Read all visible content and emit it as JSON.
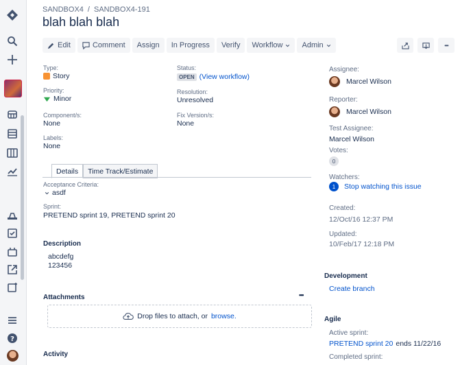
{
  "breadcrumb": {
    "project": "SANDBOX4",
    "issue_key": "SANDBOX4-191"
  },
  "issue": {
    "title": "blah blah blah"
  },
  "toolbar": {
    "edit": "Edit",
    "comment": "Comment",
    "assign": "Assign",
    "in_progress": "In Progress",
    "verify": "Verify",
    "workflow": "Workflow",
    "admin": "Admin",
    "more": "•••"
  },
  "details": {
    "type_label": "Type:",
    "type_value": "Story",
    "status_label": "Status:",
    "status_value": "OPEN",
    "status_link": "(View workflow)",
    "priority_label": "Priority:",
    "priority_value": "Minor",
    "resolution_label": "Resolution:",
    "resolution_value": "Unresolved",
    "components_label": "Component/s:",
    "components_value": "None",
    "fixversions_label": "Fix Version/s:",
    "fixversions_value": "None",
    "labels_label": "Labels:",
    "labels_value": "None"
  },
  "tabs": {
    "details": "Details",
    "timetrack": "Time Track/Estimate"
  },
  "custom": {
    "acceptance_label": "Acceptance Criteria:",
    "acceptance_value": "asdf",
    "sprint_label": "Sprint:",
    "sprint_value": "PRETEND sprint 19, PRETEND sprint 20"
  },
  "description": {
    "heading": "Description",
    "line1": "abcdefg",
    "line2": "123456"
  },
  "attachments": {
    "heading": "Attachments",
    "more": "•••",
    "drop_text": "Drop files to attach, or",
    "browse": "browse."
  },
  "activity": {
    "heading": "Activity"
  },
  "people": {
    "assignee_label": "Assignee:",
    "assignee": "Marcel Wilson",
    "reporter_label": "Reporter:",
    "reporter": "Marcel Wilson",
    "test_assignee_label": "Test Assignee:",
    "test_assignee": "Marcel Wilson",
    "votes_label": "Votes:",
    "votes": "0",
    "watchers_label": "Watchers:",
    "watchers": "1",
    "watch_link": "Stop watching this issue"
  },
  "dates": {
    "created_label": "Created:",
    "created": "12/Oct/16 12:37 PM",
    "updated_label": "Updated:",
    "updated": "10/Feb/17 12:18 PM"
  },
  "development": {
    "heading": "Development",
    "create_branch": "Create branch"
  },
  "agile": {
    "heading": "Agile",
    "active_label": "Active sprint:",
    "active_sprint": "PRETEND sprint 20",
    "active_ends": "ends 11/22/16",
    "completed_label": "Completed sprint:"
  },
  "colors": {
    "link": "#0052cc",
    "text": "#172b4d",
    "muted": "#5e6c84",
    "story": "#f79232",
    "minor": "#2fa84f"
  }
}
